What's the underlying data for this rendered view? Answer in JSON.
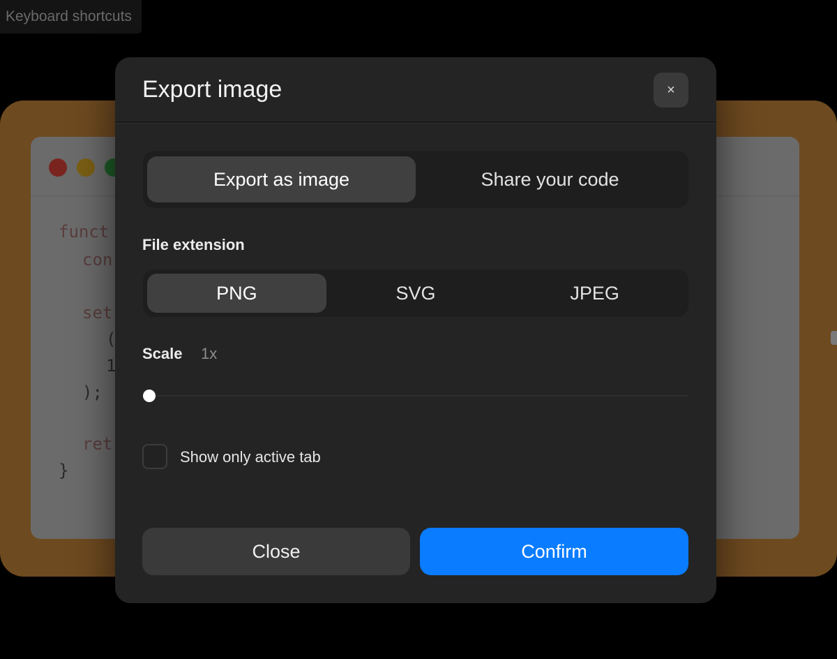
{
  "tooltip": {
    "text": "Keyboard shortcuts"
  },
  "background_editor": {
    "code_lines": [
      "funct",
      "con",
      "set",
      "(",
      "1",
      ");",
      "ret",
      "}"
    ]
  },
  "dialog": {
    "title": "Export image",
    "close_icon": "×",
    "mode_tabs": [
      {
        "label": "Export as image",
        "active": true
      },
      {
        "label": "Share your code",
        "active": false
      }
    ],
    "file_extension": {
      "label": "File extension",
      "options": [
        {
          "label": "PNG",
          "active": true
        },
        {
          "label": "SVG",
          "active": false
        },
        {
          "label": "JPEG",
          "active": false
        }
      ]
    },
    "scale": {
      "label": "Scale",
      "value_text": "1x",
      "level_fraction": 0.0
    },
    "show_only_active_tab": {
      "label": "Show only active tab",
      "checked": false
    },
    "buttons": {
      "close": "Close",
      "confirm": "Confirm"
    }
  },
  "colors": {
    "accent": "#0a7cff",
    "dialog_background": "#242424",
    "frame_background": "#6e4a20"
  }
}
